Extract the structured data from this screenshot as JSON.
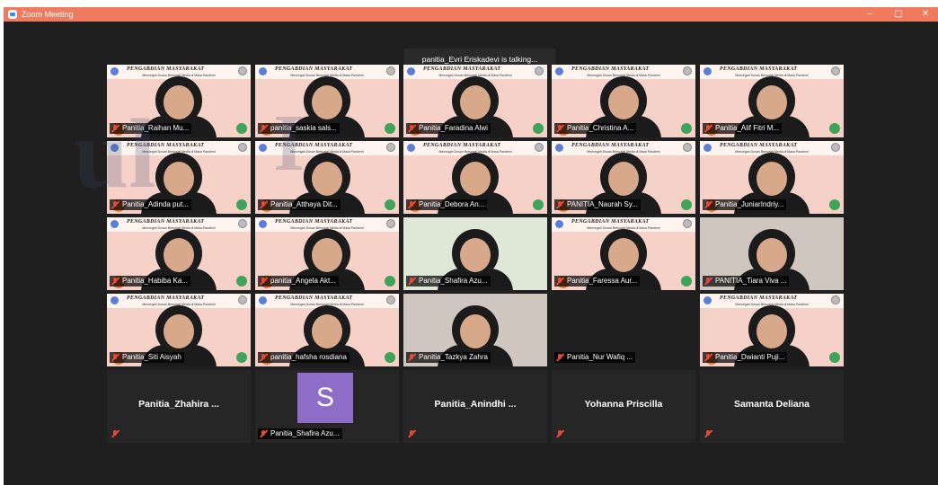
{
  "window": {
    "title": "Zoom Meeting",
    "controls": [
      "–",
      "▢",
      "✕"
    ]
  },
  "banner": {
    "speaking_text": "panitia_Evri Eriskadevi is talking..."
  },
  "slide": {
    "title": "PENGABDIAN MASYARAKAT",
    "subtitle": "Mencegah Dosan Bersosial Media di Masa Pandemi"
  },
  "participants": [
    "Panitia_Raihan Mu...",
    "panitia_saskia sals...",
    "Panitia_Faradina Alwi",
    "Panitia_Christina A...",
    "Panitia_Alif Fitri M...",
    "Panitia_Adinda put...",
    "Panitia_Atthaya Dit...",
    "Panitia_Debora An...",
    "PANITIA_Naurah Sy...",
    "Panitia_JuniarIndriy...",
    "Panitia_Habiba Ka...",
    "panitia_Angela Akt...",
    "Panitia_Shafira Azu...",
    "Panitia_Faressa Aur...",
    "PANITIA_Tiara Viva ...",
    "Panitia_Siti Aisyah",
    "panitia_hafsha rosdiana",
    "Panitia_Tazkya Zahra",
    "Panitia_Nur Wafiq ...",
    "Panitia_Dwianti Puji...",
    "Panitia_Zhahira ...",
    "Panitia_Shafira Azu...",
    "Panitia_Anindhi ...",
    "Yohanna Priscilla",
    "Samanta Deliana"
  ],
  "avatar_letter": "S",
  "colors": {
    "titlebar": "#f07a5e",
    "background": "#1f1f1f",
    "avatar": "#8d6dc7",
    "mute": "#e24a3a"
  }
}
